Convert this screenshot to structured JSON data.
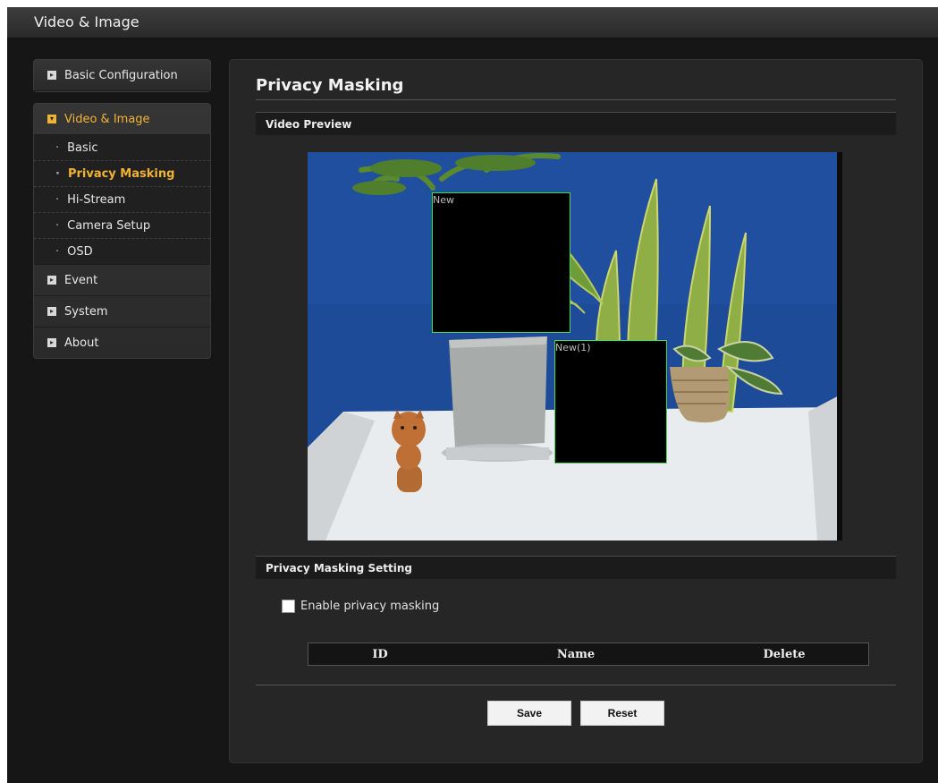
{
  "header": {
    "title": "Video & Image"
  },
  "sidebar": {
    "sections": [
      {
        "label": "Basic Configuration"
      },
      {
        "label": "Video & Image"
      },
      {
        "label": "Event"
      },
      {
        "label": "System"
      },
      {
        "label": "About"
      }
    ],
    "sub_items": [
      {
        "label": "Basic"
      },
      {
        "label": "Privacy Masking"
      },
      {
        "label": "Hi-Stream"
      },
      {
        "label": "Camera Setup"
      },
      {
        "label": "OSD"
      }
    ]
  },
  "main": {
    "title": "Privacy Masking",
    "video_section": "Video Preview",
    "masks": [
      {
        "label": "New"
      },
      {
        "label": "New(1)"
      }
    ],
    "setting_section": "Privacy Masking Setting",
    "enable_label": "Enable privacy masking",
    "table_headers": {
      "id": "ID",
      "name": "Name",
      "delete": "Delete"
    },
    "save_label": "Save",
    "reset_label": "Reset"
  }
}
